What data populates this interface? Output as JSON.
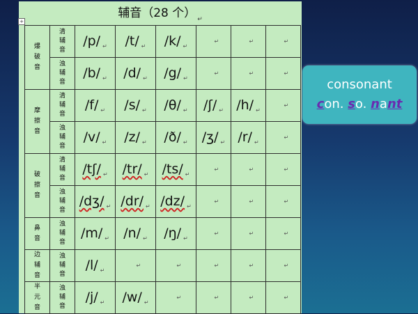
{
  "doc": {
    "title": "辅音（28 个）",
    "para_mark": "↵",
    "anchor_glyph": "+"
  },
  "table": {
    "rows": [
      {
        "category": [
          "爆",
          "破",
          "音"
        ],
        "voicing": [
          "清",
          "辅",
          "音"
        ],
        "phonemes": [
          "/p/",
          "/t/",
          "/k/"
        ]
      },
      {
        "category": [],
        "voicing": [
          "浊",
          "辅",
          "音"
        ],
        "phonemes": [
          "/b/",
          "/d/",
          "/g/"
        ]
      },
      {
        "category": [
          "摩",
          "擦",
          "音"
        ],
        "voicing": [
          "清",
          "辅",
          "音"
        ],
        "phonemes": [
          "/f/",
          "/s/",
          "/θ/",
          "/ʃ/",
          "/h/"
        ]
      },
      {
        "category": [],
        "voicing": [
          "浊",
          "辅",
          "音"
        ],
        "phonemes": [
          "/v/",
          "/z/",
          "/ð/",
          "/ʒ/",
          "/r/"
        ]
      },
      {
        "category": [
          "破",
          "擦",
          "音"
        ],
        "voicing": [
          "清",
          "辅",
          "音"
        ],
        "phonemes": [
          "/tʃ/",
          "/tr/",
          "/ts/"
        ]
      },
      {
        "category": [],
        "voicing": [
          "浊",
          "辅",
          "音"
        ],
        "phonemes": [
          "/dʒ/",
          "/dr/",
          "/dz/"
        ]
      },
      {
        "category": [
          "鼻",
          "音"
        ],
        "voicing": [
          "浊",
          "辅",
          "音"
        ],
        "phonemes": [
          "/m/",
          "/n/",
          "/ŋ/"
        ]
      },
      {
        "category": [
          "边",
          "辅",
          "音"
        ],
        "voicing": [
          "浊",
          "辅",
          "音"
        ],
        "phonemes": [
          "/l/"
        ]
      },
      {
        "category": [
          "半",
          "元",
          "音"
        ],
        "voicing": [
          "浊",
          "辅",
          "音"
        ],
        "phonemes": [
          "/j/",
          "/w/"
        ]
      }
    ]
  },
  "callout": {
    "word": "consonant",
    "syllables": [
      {
        "hl": "c",
        "rest": "on."
      },
      {
        "hl": "s",
        "rest": "o."
      },
      {
        "hl": "n",
        "mid": "a",
        "hl2": "nt"
      }
    ]
  },
  "colors": {
    "doc_background": "#c4ebc0",
    "callout_background": "#3fb5bf",
    "callout_highlight": "#6a2bb0",
    "slide_background_top": "#0f1f48",
    "slide_background_bottom": "#1b6f93"
  }
}
